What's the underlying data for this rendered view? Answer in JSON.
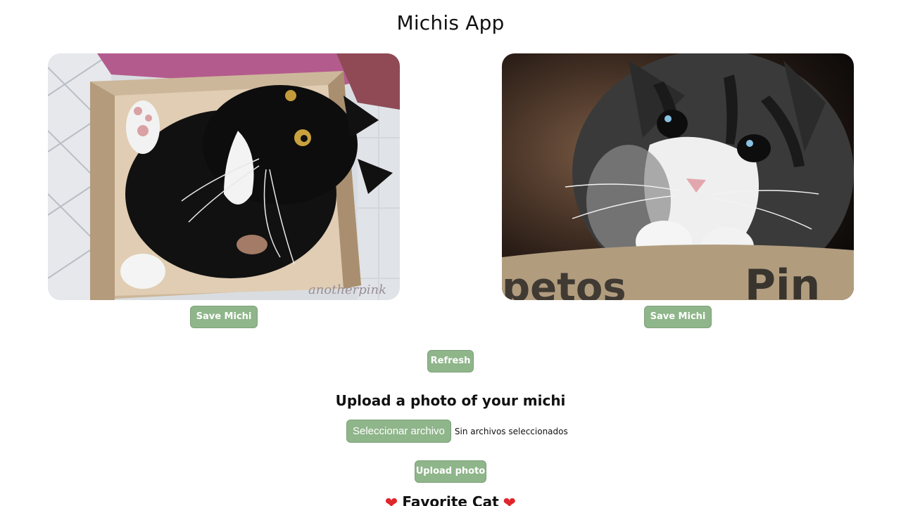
{
  "app": {
    "title": "Michis App"
  },
  "random_cats": [
    {
      "image_alt": "Black and white cat lying in a cardboard box",
      "watermark": "anotherpink",
      "save_label": "Save Michi"
    },
    {
      "image_alt": "Gray tabby kitten resting paws on a cardboard box",
      "save_label": "Save Michi"
    }
  ],
  "actions": {
    "refresh_label": "Refresh"
  },
  "upload": {
    "title": "Upload a photo of your michi",
    "file_button_label": "Seleccionar archivo",
    "file_status": "Sin archivos seleccionados",
    "upload_label": "Upload photo"
  },
  "favorites": {
    "title": "Favorite Cat",
    "heart_icon": "❤"
  },
  "colors": {
    "button_bg": "#8fb58a",
    "heart": "#e0262b"
  }
}
